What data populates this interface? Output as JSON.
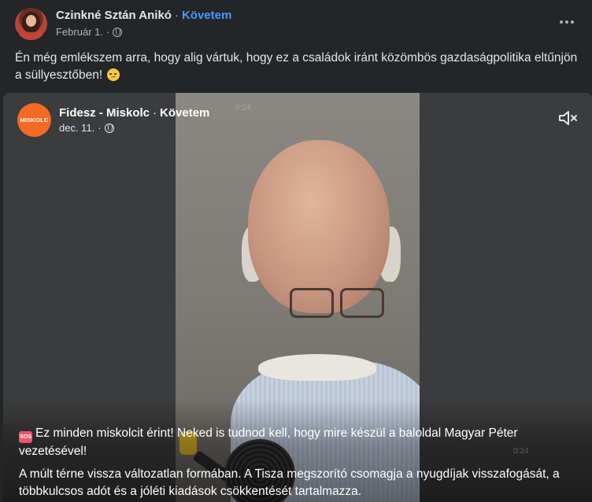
{
  "post": {
    "author": "Czinkné Sztán Anikó",
    "follow_label": "Követem",
    "date": "Február 1.",
    "separator": "·",
    "text": "Én még emlékszem arra, hogy alig vártuk, hogy ez a családok  iránt közömbös gazdaságpolitika eltűnjön a süllyesztőben!",
    "emoji": "disappointed-face-icon"
  },
  "shared": {
    "page_avatar_text": "MISKOLC",
    "page_name": "Fidesz - Miskolc",
    "follow_label": "Követem",
    "date": "dec. 11.",
    "video_time": "0:24",
    "caption_line1_icon": "sos-icon",
    "caption_line1": "Ez minden miskolcit érint! Neked is tudnod kell, hogy mire készül a baloldal Magyar Péter vezetésével!",
    "caption_line2": "A múlt térne vissza változatlan formában. A Tisza megszorító csomagja a nyugdíjak visszafogását, a többkulcsos adót és a jóléti kiadások csökkentését tartalmazza."
  },
  "colors": {
    "background": "#242526",
    "link": "#4599ff",
    "page_avatar": "#f26a24"
  }
}
